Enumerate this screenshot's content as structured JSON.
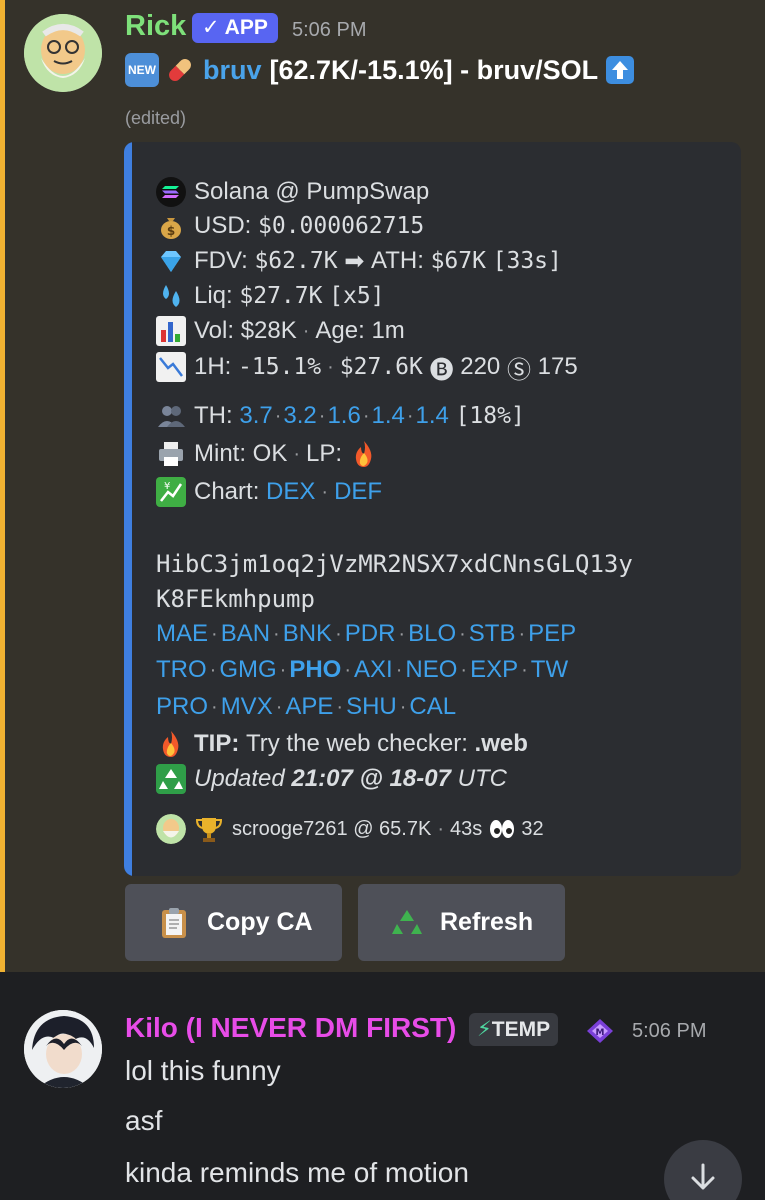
{
  "rick_message": {
    "username": "Rick",
    "app_badge": "✓ APP",
    "timestamp": "5:06 PM",
    "new_badge": "NEW",
    "token_link": "bruv",
    "title_rest": "[62.7K/-15.1%] - bruv/SOL",
    "edited": "(edited)",
    "embed": {
      "chain": "Solana @ PumpSwap",
      "usd_label": "USD:",
      "usd_value": "$0.000062715",
      "fdv_label": "FDV:",
      "fdv_value": "$62.7K",
      "ath_label": "ATH:",
      "ath_value": "$67K",
      "ath_time": "[33s]",
      "liq_label": "Liq:",
      "liq_value": "$27.7K",
      "liq_mult": "[x5]",
      "vol_label": "Vol: $28K",
      "age_label": "Age: 1m",
      "h1_label": "1H:",
      "h1_change": "-15.1%",
      "h1_volume": "$27.6K",
      "buys": "220",
      "sells": "175",
      "th_label": "TH:",
      "th_values": [
        "3.7",
        "3.2",
        "1.6",
        "1.4",
        "1.4"
      ],
      "th_percent": "[18%]",
      "mint_label": "Mint: OK",
      "lp_label": "LP:",
      "chart_label": "Chart:",
      "chart_links": [
        "DEX",
        "DEF"
      ],
      "ca_line1": "HibC3jm1oq2jVzMR2NSX7xdCNnsGLQ13y",
      "ca_line2": "K8FEkmhpump",
      "links_row1": [
        "MAE",
        "BAN",
        "BNK",
        "PDR",
        "BLO",
        "STB",
        "PEP"
      ],
      "links_row2": [
        "TRO",
        "GMG",
        "PHO",
        "AXI",
        "NEO",
        "EXP",
        "TW"
      ],
      "links_row3": [
        "PRO",
        "MVX",
        "APE",
        "SHU",
        "CAL"
      ],
      "tip_label": "TIP:",
      "tip_text": "Try the web checker:",
      "tip_cmd": ".web",
      "updated_label": "Updated",
      "updated_time": "21:07 @ 18-07",
      "updated_tz": "UTC",
      "footer_user": "scrooge7261 @ 65.7K",
      "footer_time": "43s",
      "footer_views": "32"
    },
    "buttons": {
      "copy_ca": "Copy CA",
      "refresh": "Refresh"
    }
  },
  "kilo_message": {
    "username": "Kilo (I NEVER DM FIRST)",
    "temp_badge": "TEMP",
    "timestamp": "5:06 PM",
    "lines": [
      "lol this funny",
      "asf",
      "kinda reminds me of motion"
    ]
  },
  "colors": {
    "accent": "#5865f2",
    "link": "#3ea0ea",
    "embed_bar": "#3f7fe0",
    "rick_name": "#7ee07a",
    "kilo_name": "#e84ce8"
  }
}
